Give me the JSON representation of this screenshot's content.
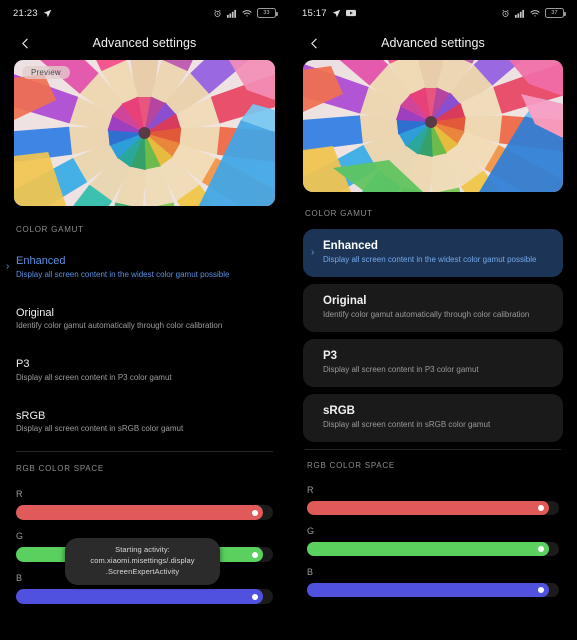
{
  "left": {
    "status": {
      "time": "21:23",
      "icons_left": [
        "location-arrow-icon"
      ],
      "icons_right": [
        "alarm-icon",
        "signal-icon",
        "wifi-icon",
        "battery-icon"
      ],
      "battery_level": "33"
    },
    "toolbar": {
      "back": "back-icon",
      "title": "Advanced settings"
    },
    "preview": {
      "badge": "Preview",
      "alt": "colored-pencils-radial"
    },
    "section_gamut_label": "COLOR GAMUT",
    "gamut_options": [
      {
        "title": "Enhanced",
        "desc": "Display all screen content in the widest color gamut possible",
        "selected": true
      },
      {
        "title": "Original",
        "desc": "Identify color gamut automatically through color calibration",
        "selected": false
      },
      {
        "title": "P3",
        "desc": "Display all screen content in P3 color gamut",
        "selected": false
      },
      {
        "title": "sRGB",
        "desc": "Display all screen content in sRGB color gamut",
        "selected": false
      }
    ],
    "section_rgb_label": "RGB COLOR SPACE",
    "sliders": [
      {
        "label": "R",
        "value": 96,
        "color": "#e05a5a"
      },
      {
        "label": "G",
        "value": 96,
        "color": "#5ad15e"
      },
      {
        "label": "B",
        "value": 96,
        "color": "#5151e0"
      }
    ],
    "toast": {
      "line1": "Starting activity: com.xiaomi.misettings/.display",
      "line2": ".ScreenExpertActivity"
    }
  },
  "right": {
    "status": {
      "time": "15:17",
      "icons_left": [
        "location-arrow-icon",
        "video-icon"
      ],
      "icons_right": [
        "alarm-icon",
        "signal-icon",
        "wifi-icon",
        "battery-icon"
      ],
      "battery_level": "37"
    },
    "toolbar": {
      "back": "back-icon",
      "title": "Advanced settings"
    },
    "preview": {
      "alt": "colored-pencils-radial"
    },
    "section_gamut_label": "COLOR GAMUT",
    "gamut_options": [
      {
        "title": "Enhanced",
        "desc": "Display all screen content in the widest color gamut possible",
        "selected": true
      },
      {
        "title": "Original",
        "desc": "Identify color gamut automatically through color calibration",
        "selected": false
      },
      {
        "title": "P3",
        "desc": "Display all screen content in P3 color gamut",
        "selected": false
      },
      {
        "title": "sRGB",
        "desc": "Display all screen content in sRGB color gamut",
        "selected": false
      }
    ],
    "section_rgb_label": "RGB COLOR SPACE",
    "sliders": [
      {
        "label": "R",
        "value": 96,
        "color": "#e05a5a"
      },
      {
        "label": "G",
        "value": 96,
        "color": "#5ad15e"
      },
      {
        "label": "B",
        "value": 96,
        "color": "#5151e0"
      }
    ]
  },
  "colors": {
    "background": "#000000",
    "accent_blue": "#5b8fe0",
    "card": "#1a1a1a",
    "card_selected": "#1c3557",
    "text_primary": "#efefef",
    "text_secondary": "#9a9a9a"
  }
}
